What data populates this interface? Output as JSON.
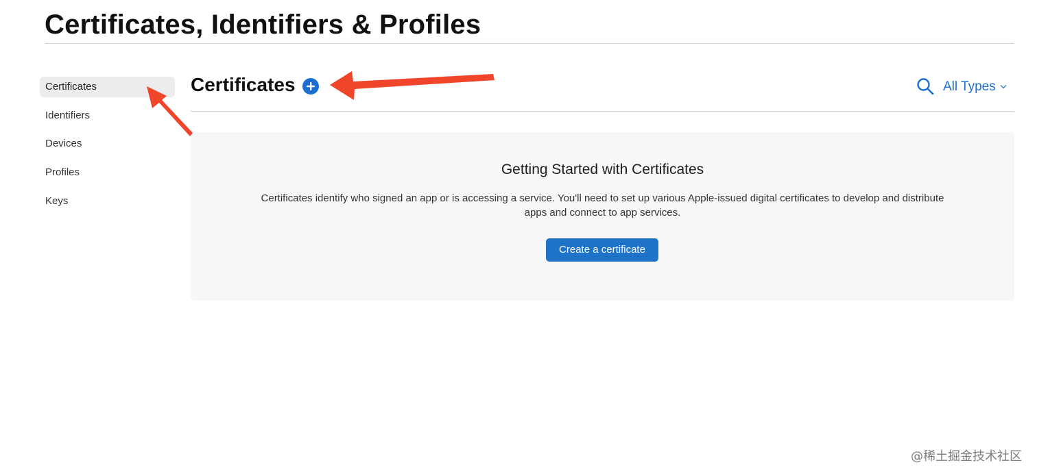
{
  "page": {
    "title": "Certificates, Identifiers & Profiles"
  },
  "sidebar": {
    "items": [
      {
        "label": "Certificates",
        "active": true
      },
      {
        "label": "Identifiers",
        "active": false
      },
      {
        "label": "Devices",
        "active": false
      },
      {
        "label": "Profiles",
        "active": false
      },
      {
        "label": "Keys",
        "active": false
      }
    ]
  },
  "main": {
    "section_title": "Certificates",
    "add_icon": "plus-circle-icon",
    "search_icon": "search-icon",
    "type_filter": {
      "selected": "All Types",
      "icon": "chevron-down-icon"
    }
  },
  "empty_state": {
    "title": "Getting Started with Certificates",
    "description": "Certificates identify who signed an app or is accessing a service. You'll need to set up various Apple-issued digital certificates to develop and distribute apps and connect to app services.",
    "button_label": "Create a certificate"
  },
  "watermark": "@稀土掘金技术社区",
  "colors": {
    "accent": "#1a6fd0",
    "button": "#1e73c9",
    "annotation": "#f0452a",
    "card_bg": "#f7f7f8"
  }
}
